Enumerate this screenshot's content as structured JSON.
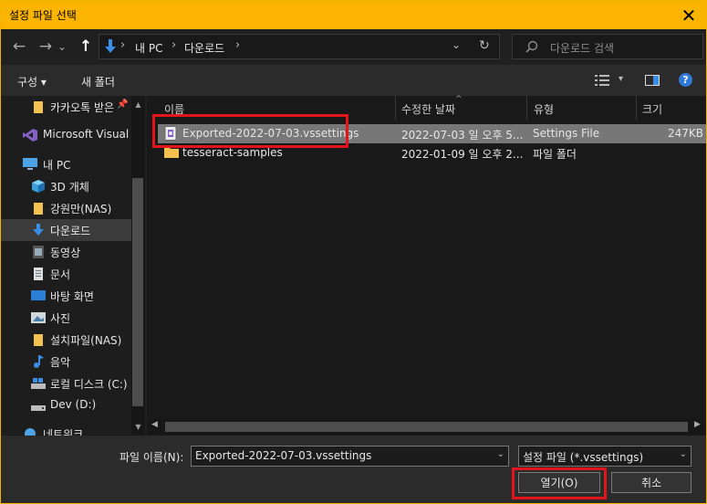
{
  "window": {
    "title": "설정 파일 선택",
    "close_glyph": "✕"
  },
  "nav": {
    "back_glyph": "←",
    "forward_glyph": "→",
    "recent_glyph": "⌄",
    "up_glyph": "↑",
    "breadcrumbs": [
      "내 PC",
      "다운로드"
    ],
    "crumb_sep": "›",
    "history_glyph": "⌄",
    "refresh_glyph": "↻",
    "search_placeholder": "다운로드 검색"
  },
  "toolbar": {
    "organize_label": "구성 ▾",
    "new_folder_label": "새 폴더",
    "view_dd_glyph": "▾",
    "help_glyph": "?"
  },
  "sidebar": {
    "items": [
      {
        "label": "카카오톡 받은",
        "icon": "folder-icon"
      },
      {
        "label": "Microsoft Visual S",
        "icon": "visual-studio-icon"
      },
      {
        "label": "내 PC",
        "icon": "pc-icon"
      },
      {
        "label": "3D 개체",
        "icon": "cube-icon"
      },
      {
        "label": "강원만(NAS)",
        "icon": "folder-icon"
      },
      {
        "label": "다운로드",
        "icon": "download-icon"
      },
      {
        "label": "동영상",
        "icon": "video-icon"
      },
      {
        "label": "문서",
        "icon": "document-icon"
      },
      {
        "label": "바탕 화면",
        "icon": "desktop-icon"
      },
      {
        "label": "사진",
        "icon": "picture-icon"
      },
      {
        "label": "설치파일(NAS)",
        "icon": "folder-icon"
      },
      {
        "label": "음악",
        "icon": "music-icon"
      },
      {
        "label": "로컬 디스크 (C:)",
        "icon": "drive-icon"
      },
      {
        "label": "Dev (D:)",
        "icon": "drive-icon"
      },
      {
        "label": "네트워크",
        "icon": "network-icon"
      }
    ]
  },
  "columns": {
    "name": "이름",
    "modified": "수정한 날짜",
    "type": "유형",
    "size": "크기"
  },
  "files": [
    {
      "name": "Exported-2022-07-03.vssettings",
      "modified": "2022-07-03 일 오후 5...",
      "type": "Settings File",
      "size": "247KB",
      "icon": "settings-file-icon"
    },
    {
      "name": "tesseract-samples",
      "modified": "2022-01-09 일 오후 2...",
      "type": "파일 폴더",
      "size": "",
      "icon": "folder-icon"
    }
  ],
  "footer": {
    "filename_label": "파일 이름(N):",
    "filename_value": "Exported-2022-07-03.vssettings",
    "filetype_value": "설정 파일 (*.vssettings)",
    "open_label": "열기(O)",
    "cancel_label": "취소"
  },
  "colors": {
    "accent": "#fbb500",
    "highlight": "#e3141b",
    "selection": "#777777"
  }
}
